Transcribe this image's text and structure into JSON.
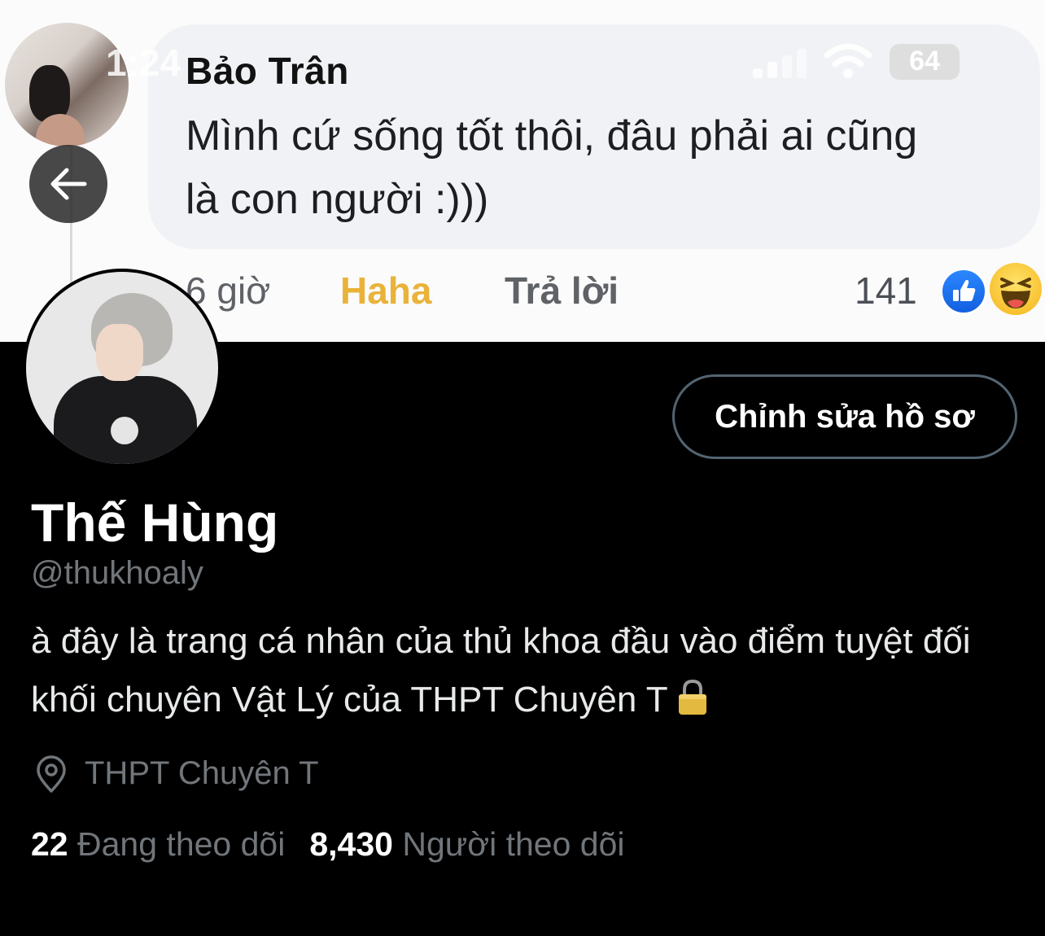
{
  "status_bar": {
    "time": "1:24",
    "battery": "64"
  },
  "comment": {
    "author": "Bảo Trân",
    "text": "Mình cứ sống tốt thôi, đâu phải ai cũng là con người :)))",
    "time": "6 giờ",
    "reaction_label": "Haha",
    "reply_label": "Trả lời",
    "reaction_count": "141"
  },
  "profile": {
    "edit_button": "Chỉnh sửa hồ sơ",
    "display_name": "Thế Hùng",
    "handle": "@thukhoaly",
    "bio": "à đây là trang cá nhân của thủ khoa đầu vào điểm tuyệt đối khối chuyên Vật Lý của THPT Chuyên T",
    "location": "THPT Chuyên T",
    "following_count": "22",
    "following_label": "Đang theo dõi",
    "followers_count": "8,430",
    "followers_label": "Người theo dõi"
  },
  "colors": {
    "background": "#000000",
    "secondary_text": "#71767b",
    "haha": "#e9b33a",
    "like_blue": "#1877f2"
  }
}
